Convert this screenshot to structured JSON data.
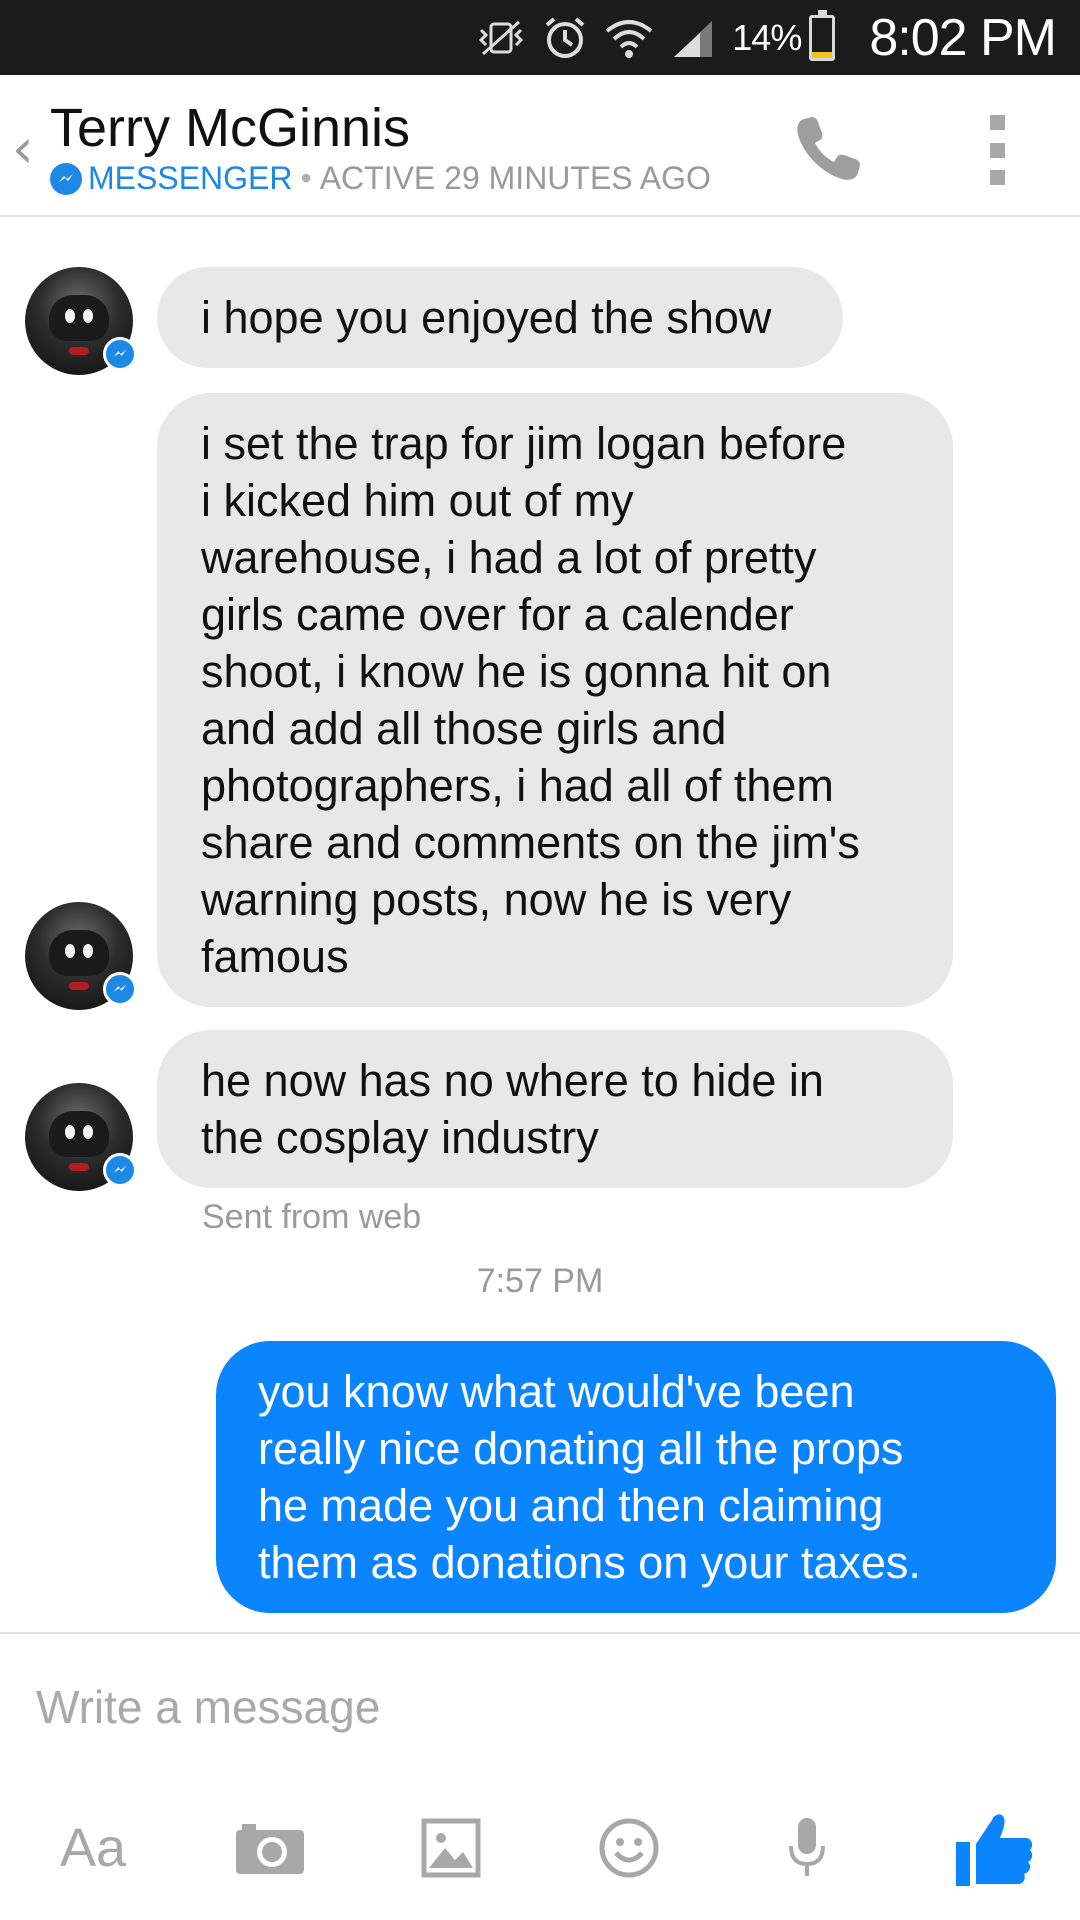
{
  "status_bar": {
    "battery_percent": "14%",
    "battery_level": 0.14,
    "time": "8:02 PM",
    "icons": [
      "mute-vibrate-icon",
      "alarm-icon",
      "wifi-icon",
      "signal-icon",
      "battery-icon"
    ]
  },
  "header": {
    "contact_name": "Terry McGinnis",
    "platform": "MESSENGER",
    "separator": "•",
    "status": "ACTIVE 29 MINUTES AGO",
    "back_icon": "‹",
    "accent": "#1e88e5"
  },
  "messages": [
    {
      "direction": "in",
      "lines": [
        "i hope you enjoyed the show"
      ]
    },
    {
      "direction": "in",
      "lines": [
        "i set the trap for jim logan before",
        "i kicked him out of my",
        "warehouse, i had a lot of pretty",
        "girls came over for a calender",
        "shoot, i know he is gonna hit on",
        "and add all those girls and",
        "photographers, i had all of them",
        "share and comments on the jim's",
        "warning posts, now he is very",
        "famous"
      ]
    },
    {
      "direction": "in",
      "lines": [
        "he now has no where to hide in",
        "the cosplay industry"
      ]
    },
    {
      "direction": "out",
      "lines": [
        "you know what would've been",
        "really nice donating all the props",
        "he made you and then claiming",
        "them as donations on your taxes."
      ]
    }
  ],
  "sent_from": "Sent from web",
  "timestamp": "7:57 PM",
  "composer": {
    "placeholder": "Write a message",
    "aa_label": "Aa"
  },
  "colors": {
    "incoming_bubble": "#e8e8e8",
    "outgoing_bubble": "#0a84ff",
    "like": "#0a84ff"
  }
}
